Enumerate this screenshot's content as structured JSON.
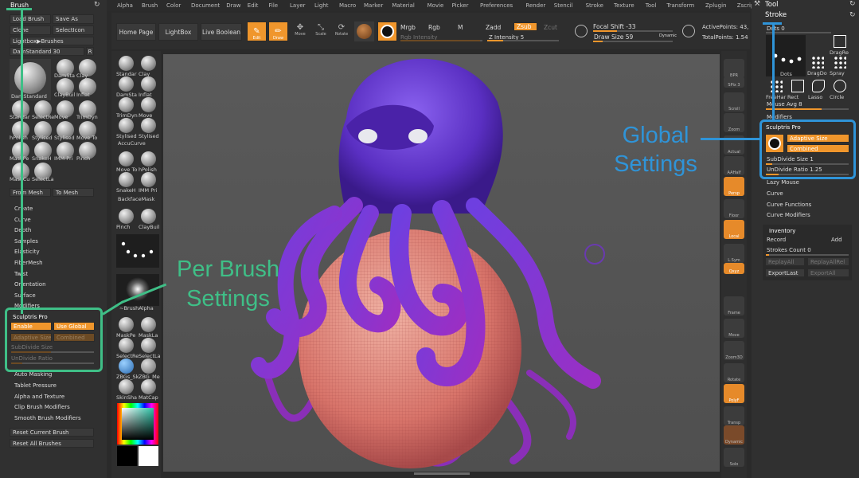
{
  "menu": [
    "Alpha",
    "Brush",
    "Color",
    "Document",
    "Draw",
    "Edit",
    "File",
    "Layer",
    "Light",
    "Macro",
    "Marker",
    "Material",
    "Movie",
    "Picker",
    "Preferences",
    "Render",
    "Stencil",
    "Stroke",
    "Texture",
    "Tool",
    "Transform",
    "Zplugin",
    "Zscript"
  ],
  "brush_palette": {
    "title": "Brush",
    "buttons": [
      "Load Brush",
      "Save As",
      "Clone",
      "SelectIcon",
      "Lightbox▶Brushes"
    ],
    "current_brush": "DamStandard",
    "current_size": "30",
    "r_label": "R",
    "thumbs": [
      "DamStandard",
      "DamSta",
      "Clay",
      "ClayBuil",
      "Inflat",
      "Standar",
      "SelectRe",
      "Move",
      "TrimDyn",
      "hPolish",
      "Stylised",
      "Stylised",
      "Move To",
      "MaskPe",
      "SnakeH",
      "IMM Pri",
      "Pinch",
      "MaskCu",
      "SelectLa"
    ],
    "from_mesh": "From Mesh",
    "to_mesh": "To Mesh",
    "sections": [
      "Create",
      "Curve",
      "Depth",
      "Samples",
      "Elasticity",
      "FiberMesh",
      "Twist",
      "Orientation",
      "Surface",
      "Modifiers"
    ],
    "sculptris_title": "Sculptris Pro",
    "enable": "Enable",
    "use_global": "Use Global",
    "adaptive_size": "Adaptive Size",
    "combined": "Combined",
    "subdivide_size": "SubDivide Size",
    "undivide_ratio": "UnDivide Ratio",
    "lower_sections": [
      "Auto Masking",
      "Tablet Pressure",
      "Alpha and Texture",
      "Clip Brush Modifiers",
      "Smooth Brush Modifiers"
    ],
    "reset_current": "Reset Current Brush",
    "reset_all": "Reset All Brushes"
  },
  "toolbar": {
    "home_page": "Home Page",
    "lightbox": "LightBox",
    "live_boolean": "Live Boolean",
    "edit": "Edit",
    "draw": "Draw",
    "move": "Move",
    "scale": "Scale",
    "rotate": "Rotate",
    "mrgb": "Mrgb",
    "rgb": "Rgb",
    "m": "M",
    "rgb_intensity": "Rgb Intensity",
    "zadd": "Zadd",
    "zsub": "Zsub",
    "zcut": "Zcut",
    "z_intensity": "Z Intensity 5",
    "focal_shift": "Focal Shift -33",
    "draw_size": "Draw Size 59",
    "dynamic": "Dynamic",
    "active_points": "ActivePoints: 43,",
    "total_points": "TotalPoints: 1.54"
  },
  "left_shelf": [
    "Standar",
    "Clay",
    "DamSta",
    "Inflat",
    "TrimDyn",
    "Move",
    "Stylised",
    "Stylised",
    "AccuCurve",
    "Move To",
    "hPolish",
    "SnakeH",
    "IMM Pri",
    "BackfaceMask",
    "Pinch",
    "ClayBuil",
    "Dots",
    "~BrushAlpha",
    "MaskPe",
    "MaskLa",
    "SelectRe",
    "SelectLa",
    "ZBGs_Sk",
    "ZBG_Me",
    "SkinSha",
    "MatCap"
  ],
  "right_shelf": [
    "BPR",
    "SPix 3",
    "Scroll",
    "Zoom",
    "Actual",
    "AAHalf",
    "Persp",
    "Floor",
    "Local",
    "L.Sym",
    "Qxyz",
    "Frame",
    "Move",
    "Zoom3D",
    "Rotate",
    "PolyF",
    "Transp",
    "Dynamic",
    "Solo"
  ],
  "tool_palette": {
    "tool_title": "Tool",
    "stroke_title": "Stroke",
    "dots_label": "Dots 0",
    "stroke_types": [
      "Dots",
      "DragRe",
      "DragDo",
      "Spray",
      "FreeHar",
      "Rect",
      "Lasso",
      "Circle"
    ],
    "mouse_avg": "Mouse Avg 8",
    "modifiers": "Modifiers",
    "sculptris_title": "Sculptris Pro",
    "adaptive_size": "Adaptive Size",
    "combined": "Combined",
    "subdivide_size": "SubDivide Size 1",
    "undivide_ratio": "UnDivide Ratio 1.25",
    "lazy_mouse": "Lazy Mouse",
    "curve": "Curve",
    "curve_functions": "Curve Functions",
    "curve_modifiers": "Curve Modifiers",
    "inventory": "Inventory",
    "record": "Record",
    "add": "Add",
    "strokes_count": "Strokes Count 0",
    "replay_all": "ReplayAll",
    "replay_all_rel": "ReplayAllRel",
    "export_last": "ExportLast",
    "export_all": "ExportAll"
  },
  "annotations": {
    "global": "Global\nSettings",
    "per_brush": "Per Brush\nSettings",
    "global_color": "#2f94d8",
    "per_brush_color": "#3fbf87"
  }
}
